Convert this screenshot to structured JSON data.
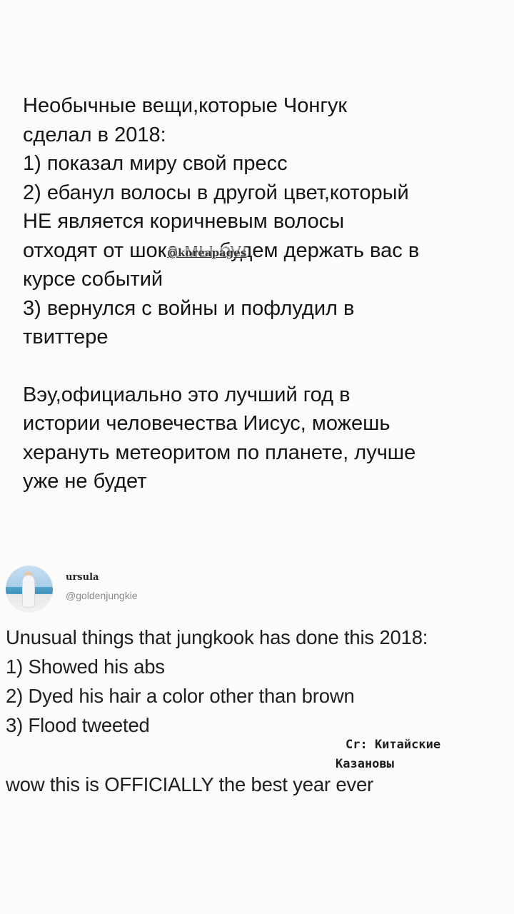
{
  "translation": {
    "title_line1": "Необычные вещи,которые Чонгук",
    "title_line2": "сделал в 2018:",
    "item1": "1) показал миру свой пресс",
    "item2_line1": "2) ебанул волосы в другой цвет,который",
    "item2_line2": "НЕ является коричневым волосы",
    "item2_line3": "отходят от шока мы будем держать вас в",
    "item2_line4": "курсе событий",
    "item3_line1": "3) вернулся с войны и пофлудил в",
    "item3_line2": "твиттере",
    "outro_line1": "Вэу,официально это лучший год в",
    "outro_line2": "истории человечества Иисус, можешь",
    "outro_line3": "херануть метеоритом по планете, лучше",
    "outro_line4": "уже не будет"
  },
  "watermark": "@koreapages",
  "tweet": {
    "display_name": "ursula",
    "username": "@goldenjungkie",
    "line1": "Unusual things that jungkook has done this 2018:",
    "line2": "1) Showed his abs",
    "line3": "2) Dyed his hair a color other than brown",
    "line4": "3) Flood tweeted",
    "line5": "wow this is OFFICIALLY the best year ever"
  },
  "credit": {
    "line1": "Cr: Китайские",
    "line2": "Казановы"
  }
}
